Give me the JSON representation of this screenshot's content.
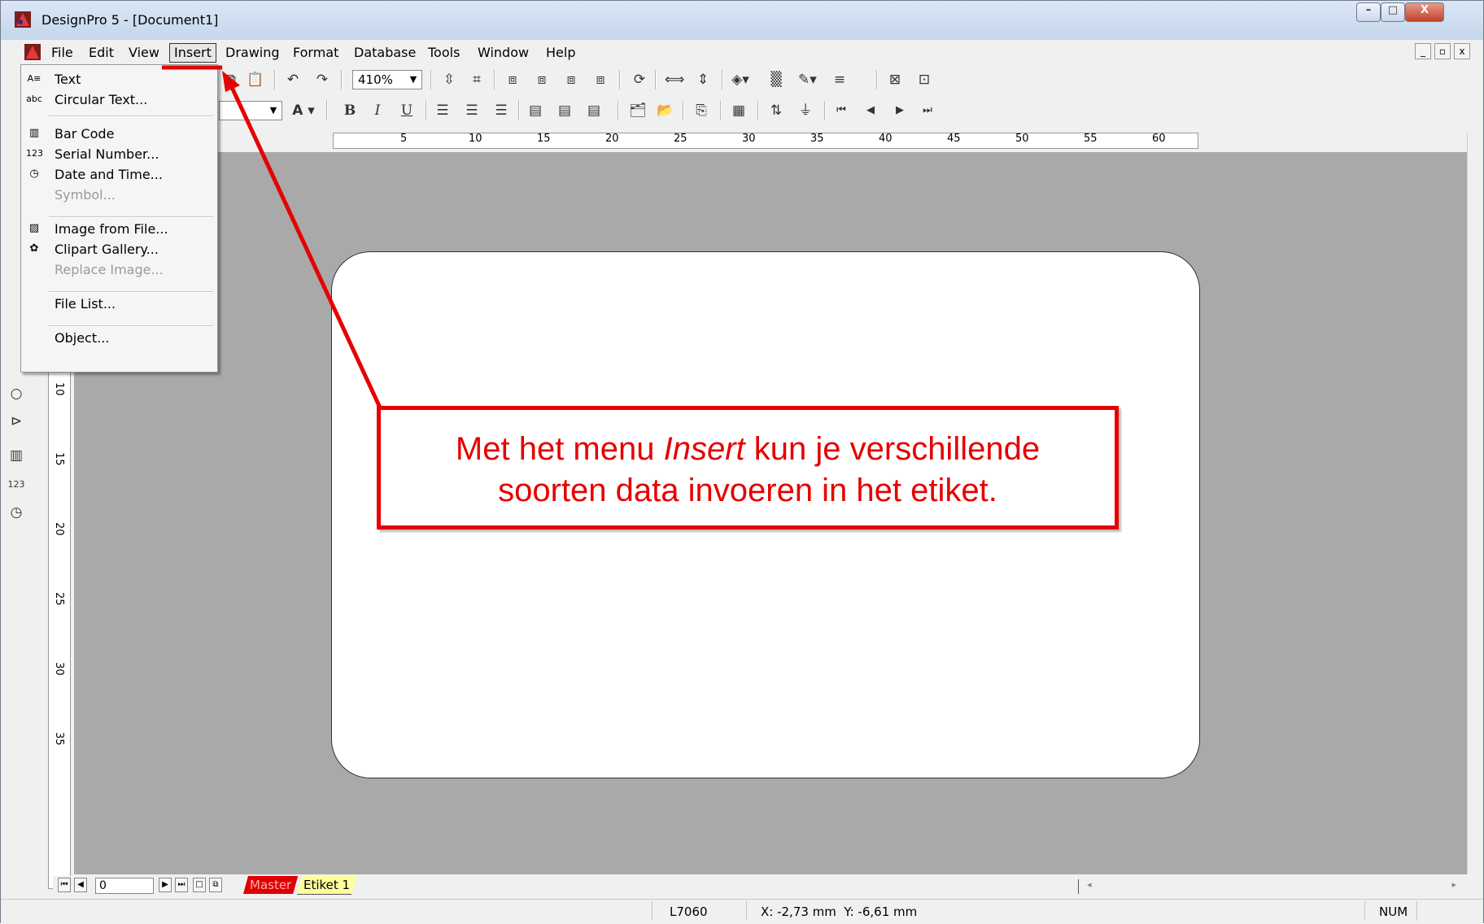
{
  "window": {
    "title": "DesignPro 5 - [Document1]",
    "minimize": "–",
    "maximize": "□",
    "close": "X"
  },
  "menubar": {
    "items": [
      "File",
      "Edit",
      "View",
      "Insert",
      "Drawing",
      "Format",
      "Database",
      "Tools",
      "Window",
      "Help"
    ]
  },
  "mdi": {
    "minimize": "_",
    "restore": "▫",
    "close": "x"
  },
  "toolbar1": {
    "zoom": "410%"
  },
  "toolbar2": {
    "bold": "B",
    "italic": "I",
    "underline": "U",
    "font_color_label": "A"
  },
  "ruler": {
    "h_ticks": [
      "5",
      "10",
      "15",
      "20",
      "25",
      "30",
      "35",
      "40",
      "45",
      "50",
      "55",
      "60"
    ],
    "v_ticks": [
      "10",
      "15",
      "20",
      "25",
      "30",
      "35"
    ]
  },
  "insert_menu": {
    "items": [
      {
        "label": "Text",
        "icon": "text-frame-icon",
        "enabled": true
      },
      {
        "label": "Circular Text...",
        "icon": "circular-text-icon",
        "enabled": true
      },
      {
        "label": "Bar Code",
        "icon": "barcode-icon",
        "enabled": true
      },
      {
        "label": "Serial Number...",
        "icon": "serial-number-icon",
        "enabled": true
      },
      {
        "label": "Date and Time...",
        "icon": "date-time-icon",
        "enabled": true
      },
      {
        "label": "Symbol...",
        "icon": "",
        "enabled": false
      },
      {
        "label": "Image from File...",
        "icon": "image-file-icon",
        "enabled": true
      },
      {
        "label": "Clipart Gallery...",
        "icon": "clipart-icon",
        "enabled": true
      },
      {
        "label": "Replace Image...",
        "icon": "",
        "enabled": false
      },
      {
        "label": "File List...",
        "icon": "",
        "enabled": true
      },
      {
        "label": "Object...",
        "icon": "",
        "enabled": true
      }
    ]
  },
  "page_nav": {
    "page": "0"
  },
  "tabs": [
    "Master",
    "Etiket 1"
  ],
  "status": {
    "template": "L7060",
    "coords": "X: -2,73 mm  Y: -6,61 mm",
    "num": "NUM"
  },
  "callout": {
    "line1_before": "Met het menu ",
    "line1_italic": "Insert",
    "line1_after": " kun je verschillende",
    "line2": "soorten data invoeren in het etiket."
  },
  "colors": {
    "annotation": "#e60000",
    "canvas": "#a9a9a9",
    "master_tab": "#e00000",
    "etiket_tab": "#ffff9c"
  }
}
